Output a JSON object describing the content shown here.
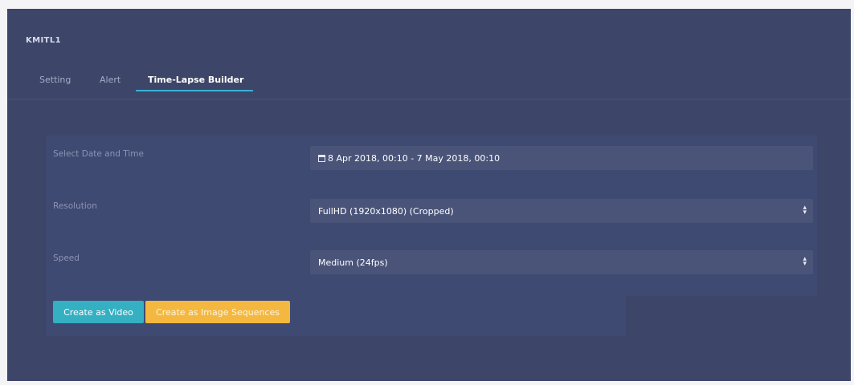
{
  "panel": {
    "title": "KMITL1"
  },
  "tabs": [
    {
      "label": "Setting",
      "active": false
    },
    {
      "label": "Alert",
      "active": false
    },
    {
      "label": "Time-Lapse Builder",
      "active": true
    }
  ],
  "form": {
    "date_label": "Select Date and Time",
    "date_value": "8 Apr 2018, 00:10 - 7 May 2018, 00:10",
    "date_icon": "calendar-icon",
    "resolution_label": "Resolution",
    "resolution_value": "FullHD (1920x1080) (Cropped)",
    "speed_label": "Speed",
    "speed_value": "Medium (24fps)",
    "select_icon": "select-arrows-icon"
  },
  "buttons": {
    "video_label": "Create as Video",
    "images_label": "Create as Image Sequences"
  },
  "colors": {
    "background": "#3d4668",
    "accent": "#39b1d6",
    "video_button": "#35afc2",
    "images_button": "#f4b840"
  }
}
